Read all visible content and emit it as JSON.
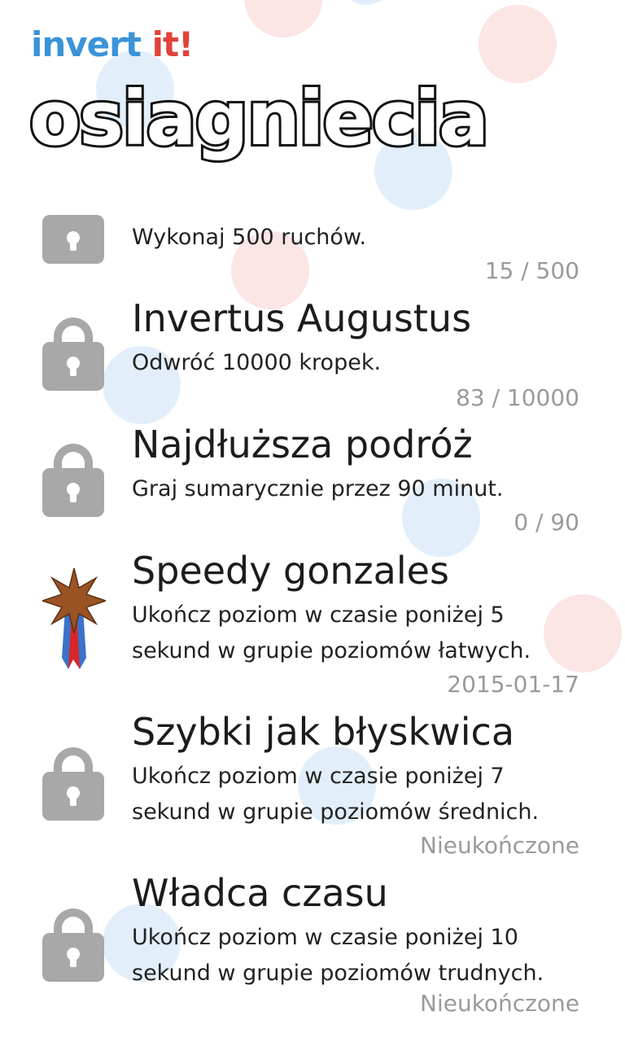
{
  "brand": {
    "part1": "invert",
    "part2": "it!"
  },
  "page_title": "osiagniecia",
  "achievements": [
    {
      "title": "",
      "desc": "Wykonaj 500 ruchów.",
      "status": "15 / 500",
      "icon": "lock-icon"
    },
    {
      "title": "Invertus Augustus",
      "desc": "Odwróć 10000 kropek.",
      "status": "83 / 10000",
      "icon": "lock-icon"
    },
    {
      "title": "Najdłuższa podróż",
      "desc": "Graj sumarycznie przez 90 minut.",
      "status": "0 / 90",
      "icon": "lock-icon"
    },
    {
      "title": "Speedy gonzales",
      "desc": "Ukończ poziom w czasie poniżej 5 sekund w grupie poziomów łatwych.",
      "status": "2015-01-17",
      "icon": "bronze-medal-icon"
    },
    {
      "title": "Szybki jak błyskwica",
      "desc": "Ukończ poziom w czasie poniżej 7 sekund w grupie poziomów średnich.",
      "status": "Nieukończone",
      "icon": "lock-icon"
    },
    {
      "title": "Władca czasu",
      "desc": "Ukończ poziom w czasie poniżej 10 sekund w grupie poziomów trudnych.",
      "status": "Nieukończone",
      "icon": "lock-icon"
    }
  ],
  "colors": {
    "brand_blue": "#3b93d8",
    "brand_red": "#e0433b",
    "lock_gray": "#a8a8a8",
    "bronze": "#8a4a22"
  }
}
